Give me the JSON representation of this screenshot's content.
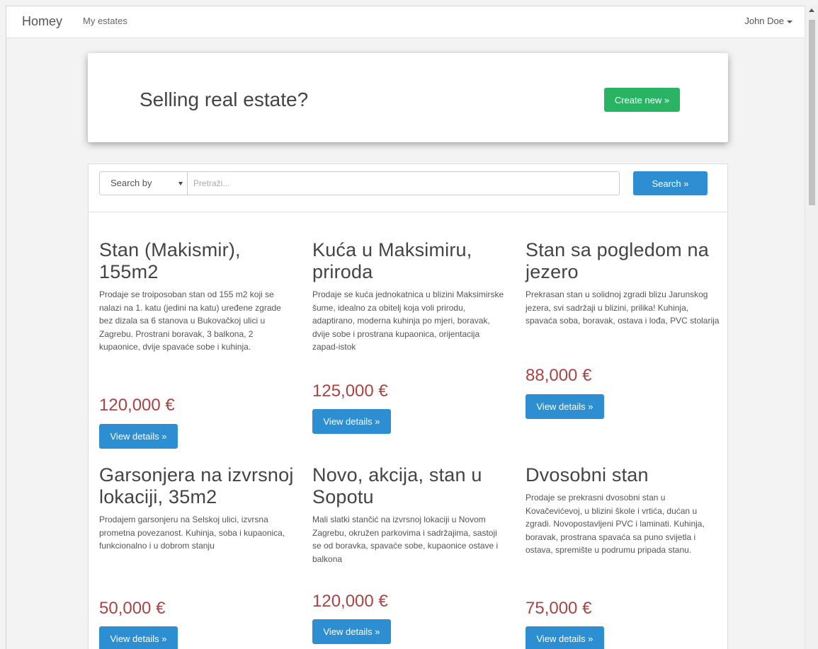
{
  "navbar": {
    "brand": "Homey",
    "my_estates": "My estates",
    "user": "John Doe"
  },
  "jumbotron": {
    "title": "Selling real estate?",
    "create_button": "Create new »"
  },
  "search": {
    "select_value": "Search by",
    "placeholder": "Pretraži...",
    "button": "Search »"
  },
  "listings": [
    {
      "title": "Stan (Makismir), 155m2",
      "description": "Prodaje se troiposoban stan od 155 m2 koji se nalazi na 1. katu (jedini na katu) uređene zgrade bez dizala sa 6 stanova u Bukovačkoj ulici u Zagrebu. Prostrani boravak, 3 balkona, 2 kupaonice, dvije spavaće sobe i kuhinja.",
      "price": "120,000 €",
      "button": "View details »"
    },
    {
      "title": "Kuća u Maksimiru, priroda",
      "description": "Prodaje se kuća jednokatnica u blizini Maksimirske šume, idealno za obitelj koja voli prirodu, adaptirano, moderna kuhinja po mjeri, boravak, dvije sobe i prostrana kupaonica, orijentacija zapad-istok",
      "price": "125,000 €",
      "button": "View details »"
    },
    {
      "title": "Stan sa pogledom na jezero",
      "description": "Prekrasan stan u solidnoj zgradi blizu Jarunskog jezera, svi sadržaji u blizini, prilika! Kuhinja, spavaća soba, boravak, ostava i lođa, PVC stolarija",
      "price": "88,000 €",
      "button": "View details »"
    },
    {
      "title": "Garsonjera na izvrsnoj lokaciji, 35m2",
      "description": "Prodajem garsonjeru na Selskoj ulici, izvrsna prometna povezanost. Kuhinja, soba i kupaonica, funkcionalno i u dobrom stanju",
      "price": "50,000 €",
      "button": "View details »"
    },
    {
      "title": "Novo, akcija, stan u Sopotu",
      "description": "Mali slatki stančić na izvrsnoj lokaciji u Novom Zagrebu, okružen parkovima i sadržajima, sastoji se od boravka, spavaće sobe, kupaonice ostave i balkona",
      "price": "120,000 €",
      "button": "View details »"
    },
    {
      "title": "Dvosobni stan",
      "description": "Prodaje se prekrasni dvosobni stan u Kovačevićevoj, u blizini škole i vrtića, dućan u zgradi. Novopostavljeni PVC i laminati. Kuhinja, boravak, prostrana spavaća sa puno svijetla i ostava, spremište u podrumu pripada stanu.",
      "price": "75,000 €",
      "button": "View details »"
    }
  ]
}
